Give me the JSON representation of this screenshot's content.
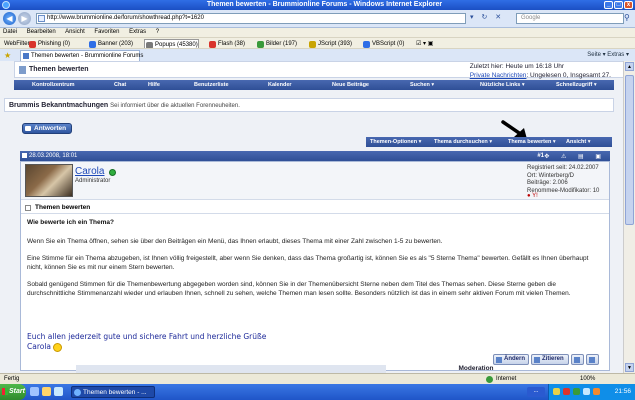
{
  "window": {
    "title": "Themen bewerten - Brummionline Forums - Windows Internet Explorer",
    "minimize": "_",
    "maximize": "□",
    "close": "x"
  },
  "address": {
    "url": "http://www.brummionline.de/forum/showthread.php?t=1620",
    "search_placeholder": "Google"
  },
  "menu": [
    "Datei",
    "Bearbeiten",
    "Ansicht",
    "Favoriten",
    "Extras",
    "?"
  ],
  "toolbar": {
    "label": "WebFilter",
    "items": [
      {
        "label": "Phishing (0)",
        "color": "#d9342b"
      },
      {
        "label": "Banner (203)",
        "color": "#2f6ee6"
      },
      {
        "label": "Popups (45380)",
        "color": "#7a7a7a"
      },
      {
        "label": "Flash (38)",
        "color": "#d9342b"
      },
      {
        "label": "Bilder (197)",
        "color": "#3a9a3a"
      },
      {
        "label": "JScript (393)",
        "color": "#c9a400"
      },
      {
        "label": "VBScript (0)",
        "color": "#2f6ee6"
      }
    ]
  },
  "tabs": {
    "active": "Themen bewerten - Brummionline Forums",
    "right_tools": "Seite ▾   Extras ▾"
  },
  "forum": {
    "breadcrumb_title": "Themen bewerten",
    "user_info_line1": "Zuletzt hier: Heute um 16:18 Uhr",
    "pm_link": "Private Nachrichten",
    "pm_status": ": Ungelesen 0, Insgesamt 27."
  },
  "navbar": [
    "Kontrollzentrum",
    "Chat",
    "Hilfe",
    "Benutzerliste",
    "Kalender",
    "Neue Beiträge",
    "Suchen ▾",
    "Nützliche Links ▾",
    "Schnellzugriff ▾"
  ],
  "announcement": {
    "title": "Brummis Bekanntmachungen",
    "description": "Sei informiert über die aktuellen Forenneuheiten."
  },
  "reply_button": "Antworten",
  "thread_tools": [
    "Themen-Optionen ▾",
    "Thema durchsuchen ▾",
    "Thema bewerten ▾",
    "Ansicht ▾"
  ],
  "post": {
    "date": "28.03.2008, 18:01",
    "number": "#1",
    "username": "Carola",
    "role": "Administrator",
    "info": [
      "Registriert seit: 24.02.2007",
      "Ort: Winterberg/D",
      "Beiträge: 2.006",
      "Renommee-Modifikator: 10"
    ],
    "title": "Themen bewerten",
    "question": "Wie bewerte ich ein Thema?",
    "paragraphs": [
      "Wenn Sie ein Thema öffnen, sehen sie über den Beiträgen ein Menü, das Ihnen erlaubt, dieses Thema mit einer Zahl zwischen 1-5 zu bewerten.",
      "Eine Stimme für ein Thema abzugeben, ist Ihnen völlig freigestellt, aber wenn Sie denken, dass das Thema großartig ist, können Sie es als \"5 Sterne Thema\" bewerten. Gefällt es Ihnen überhaupt nicht, können Sie es mit nur einem Stern bewerten.",
      "Sobald genügend Stimmen für die Themenbewertung abgegeben worden sind, können Sie in der Themenübersicht Sterne neben dem Titel des Themas sehen. Diese Sterne geben die durchschnittliche Stimmenanzahl wieder und erlauben Ihnen, schnell zu sehen, welche Themen man lesen sollte. Besonders nützlich ist das in einem sehr aktiven Forum mit vielen Themen."
    ],
    "signature_line1": "Euch allen jederzeit gute und sichere Fahrt und herzliche Grüße",
    "signature_line2": "Carola",
    "edit_button": "Ändern",
    "quote_button": "Zitieren"
  },
  "moderation_label": "Moderation",
  "status": {
    "left": "Fertig",
    "zone": "Internet",
    "zoom": "100%"
  },
  "taskbar": {
    "start": "Start",
    "task": "Themen bewerten - ...",
    "mid": "...",
    "clock": "21:56"
  }
}
